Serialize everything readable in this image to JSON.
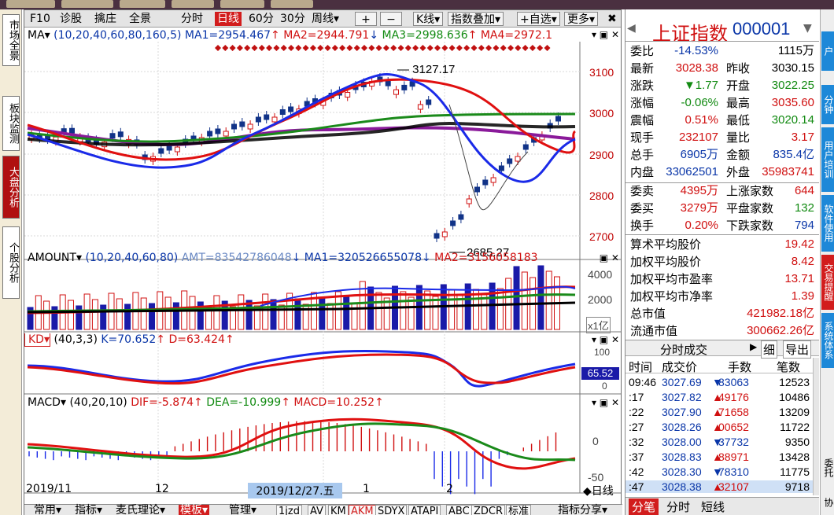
{
  "top_tabs": [
    "",
    "",
    "",
    "",
    "",
    ""
  ],
  "left_tabs": [
    {
      "label": "市场全景",
      "active": false
    },
    {
      "label": "板块监测",
      "active": false
    },
    {
      "label": "大盘分析",
      "active": true
    },
    {
      "label": "个股分析",
      "active": false
    }
  ],
  "toolbar": {
    "items": [
      "F10",
      "诊股",
      "擒庄",
      "全景"
    ],
    "periods": [
      "分时",
      "日线",
      "60分",
      "30分",
      "周线▾"
    ],
    "selected_period": "日线",
    "plus": "+",
    "minus": "−",
    "kline": "K线▾",
    "indicator_overlay": "指数叠加▾",
    "add_fav": "+自选▾",
    "more": "更多▾",
    "close": "✖"
  },
  "price_panel": {
    "title_prefix": "MA▾",
    "params": "(10,20,40,60,80,160,5)",
    "ma1": "MA1=2954.467",
    "ma1_arrow": "↑",
    "ma2": "MA2=2944.791",
    "ma2_arrow": "↓",
    "ma3": "MA3=2998.636",
    "ma3_arrow": "↑",
    "ma4": "MA4=2972.1",
    "y_ticks": [
      "3100",
      "3000",
      "2900",
      "2800",
      "2700"
    ],
    "high_label": "3127.17",
    "low_label": "2685.27"
  },
  "amount_panel": {
    "title": "AMOUNT▾",
    "params": "(10,20,40,60,80)",
    "amt": "AMT=83542786048",
    "amt_arrow": "↓",
    "ma1": "MA1=320526655078",
    "ma1_arrow": "↓",
    "ma2": "MA2=3156058183",
    "y_ticks": [
      "4000",
      "2000"
    ],
    "unit": "x1亿"
  },
  "kd_panel": {
    "title": "KD▾",
    "params": "(40,3,3)",
    "k": "K=70.652",
    "k_arrow": "↑",
    "d": "D=63.424",
    "d_arrow": "↑",
    "y_ticks": [
      "100",
      "50",
      "0"
    ],
    "value_box": "65.52"
  },
  "macd_panel": {
    "title": "MACD▾",
    "params": "(40,20,10)",
    "dif": "DIF=-5.874",
    "dif_arrow": "↑",
    "dea": "DEA=-10.999",
    "dea_arrow": "↑",
    "macd": "MACD=10.252",
    "macd_arrow": "↑",
    "y_ticks": [
      "0",
      "-50"
    ]
  },
  "x_axis": {
    "labels": [
      "2019/11",
      "12",
      "2019/12/27.五",
      "1",
      "2"
    ],
    "period_label": "◆日线"
  },
  "bottom_bar": {
    "items": [
      "常用▾",
      "指标▾",
      "麦氏理论▾",
      "模板▾",
      "管理▾"
    ],
    "selected": "模板▾",
    "indicators": [
      "1jzd",
      "AV",
      "KM",
      "AKM",
      "SDYX",
      "ATAPI",
      "ABC",
      "ZDCR",
      "标准"
    ],
    "selected_indicator": "AKM",
    "share": "指标分享▾"
  },
  "quote": {
    "name": "上证指数",
    "code": "000001",
    "rows": [
      [
        {
          "k": "委比",
          "v": "-14.53%",
          "c": "blue"
        },
        {
          "k": "",
          "v": "1115万",
          "c": "black"
        }
      ],
      [
        {
          "k": "最新",
          "v": "3028.38",
          "c": "red"
        },
        {
          "k": "昨收",
          "v": "3030.15",
          "c": "black"
        }
      ],
      [
        {
          "k": "涨跌",
          "v": "▼1.77",
          "c": "green"
        },
        {
          "k": "开盘",
          "v": "3022.25",
          "c": "green"
        }
      ],
      [
        {
          "k": "涨幅",
          "v": "-0.06%",
          "c": "green"
        },
        {
          "k": "最高",
          "v": "3035.60",
          "c": "red"
        }
      ],
      [
        {
          "k": "震幅",
          "v": "0.51%",
          "c": "red"
        },
        {
          "k": "最低",
          "v": "3020.14",
          "c": "green"
        }
      ],
      [
        {
          "k": "现手",
          "v": "232107",
          "c": "red"
        },
        {
          "k": "量比",
          "v": "3.17",
          "c": "red"
        }
      ],
      [
        {
          "k": "总手",
          "v": "6905万",
          "c": "blue"
        },
        {
          "k": "金额",
          "v": "835.4亿",
          "c": "blue"
        }
      ],
      [
        {
          "k": "内盘",
          "v": "33062501",
          "c": "blue"
        },
        {
          "k": "外盘",
          "v": "35983741",
          "c": "red"
        }
      ]
    ],
    "rows2": [
      [
        {
          "k": "委卖",
          "v": "4395万",
          "c": "red"
        },
        {
          "k": "上涨家数",
          "v": "644",
          "c": "red"
        }
      ],
      [
        {
          "k": "委买",
          "v": "3279万",
          "c": "red"
        },
        {
          "k": "平盘家数",
          "v": "132",
          "c": "green"
        }
      ],
      [
        {
          "k": "换手",
          "v": "0.20%",
          "c": "red"
        },
        {
          "k": "下跌家数",
          "v": "794",
          "c": "blue"
        }
      ]
    ],
    "stats": [
      {
        "k": "算术平均股价",
        "v": "19.42"
      },
      {
        "k": "加权平均股价",
        "v": "8.42"
      },
      {
        "k": "加权平均市盈率",
        "v": "13.71"
      },
      {
        "k": "加权平均市净率",
        "v": "1.39"
      },
      {
        "k": "总市值",
        "v": "421982.18亿"
      },
      {
        "k": "流通市值",
        "v": "300662.26亿"
      }
    ],
    "ticks_header": "分时成交",
    "ticks_btn_detail": "细",
    "ticks_btn_export": "导出",
    "ticks_cols": [
      "时间",
      "成交价",
      "手数",
      "笔数"
    ],
    "ticks": [
      {
        "t": "09:46",
        "p": "3027.69",
        "a": "▼",
        "v": "83063",
        "n": "12523"
      },
      {
        "t": ":17",
        "p": "3027.82",
        "a": "▲",
        "v": "49176",
        "n": "10486"
      },
      {
        "t": ":22",
        "p": "3027.90",
        "a": "▲",
        "v": "71658",
        "n": "13209"
      },
      {
        "t": ":27",
        "p": "3028.26",
        "a": "▲",
        "v": "00652",
        "n": "11722"
      },
      {
        "t": ":32",
        "p": "3028.00",
        "a": "▼",
        "v": "37732",
        "n": "9350"
      },
      {
        "t": ":37",
        "p": "3028.83",
        "a": "▲",
        "v": "88971",
        "n": "13428"
      },
      {
        "t": ":42",
        "p": "3028.30",
        "a": "▼",
        "v": "78310",
        "n": "11775"
      },
      {
        "t": ":47",
        "p": "3028.38",
        "a": "▲",
        "v": "32107",
        "n": "9718"
      }
    ],
    "bottom_tabs": [
      "分笔",
      "分时",
      "短线"
    ],
    "bottom_selected": "分笔"
  },
  "edge_tabs": [
    "户",
    "分钟",
    "用户培训",
    "软件使用",
    "交易提醒",
    "系统体系",
    "委托",
    "协"
  ]
}
